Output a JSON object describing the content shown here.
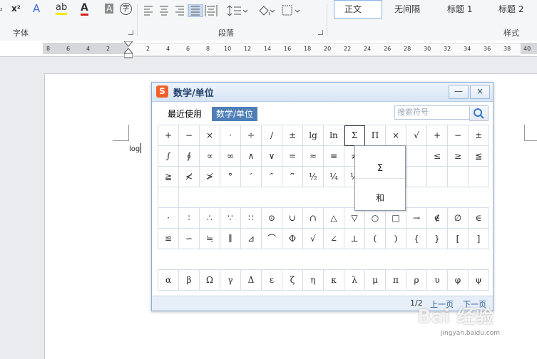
{
  "ribbon": {
    "font_buttons": [
      "₂",
      "x²",
      "A",
      "ab",
      "A",
      "A",
      "字"
    ],
    "para_label": "段落",
    "font_label": "字体",
    "styles_label": "样式",
    "styles": [
      "正文",
      "无间隔",
      "标题 1",
      "标题 2"
    ]
  },
  "ruler": {
    "ticks": [
      "8",
      "6",
      "4",
      "2",
      "2",
      "4",
      "6",
      "8",
      "10",
      "12",
      "14",
      "16",
      "18",
      "20",
      "22",
      "24",
      "26",
      "28",
      "30",
      "32",
      "34",
      "36",
      "38",
      "40"
    ]
  },
  "document": {
    "text": "log"
  },
  "dialog": {
    "logo": "S",
    "title": "数学/单位",
    "minimize": "—",
    "close": "×",
    "tabs": [
      "最近使用",
      "数学/单位"
    ],
    "search_placeholder": "搜索符号",
    "rows_a": [
      "+",
      "−",
      "×",
      "·",
      "÷",
      "∕",
      "±",
      "lg",
      "ln",
      "Σ",
      "Π",
      "×",
      "√",
      "+",
      "−",
      "±",
      "∫",
      "∮",
      "∝",
      "∞",
      "∧",
      "∨",
      "=",
      "≈",
      "≡",
      "≠",
      "",
      "",
      "",
      "≤",
      "≥",
      "≦",
      "≧",
      "≮",
      "≯",
      "°",
      "′",
      "″",
      "‴",
      "½",
      "¼",
      "⅓",
      "",
      "",
      "",
      "",
      "",
      "",
      ""
    ],
    "rows_b": [
      "·",
      "∶",
      "∴",
      "∵",
      "∷",
      "⊙",
      "∪",
      "∩",
      "△",
      "▽",
      "○",
      "□",
      "→",
      "∉",
      "∅",
      "∈",
      "≌",
      "∽",
      "≒",
      "∥",
      "⊿",
      "⌒",
      "Φ",
      "√",
      "∠",
      "⊥",
      "(",
      ")",
      "{",
      "}",
      "[",
      "]"
    ],
    "rows_c": [
      "α",
      "β",
      "Ω",
      "γ",
      "Δ",
      "ε",
      "ζ",
      "η",
      "κ",
      "λ",
      "μ",
      "π",
      "ρ",
      "υ",
      "φ",
      "ψ"
    ],
    "popup": [
      "Σ",
      "和"
    ],
    "page_indicator": "1/2",
    "prev": "上一页",
    "next": "下一页"
  },
  "watermark": {
    "text": "Bai 经验",
    "sub": "jingyan.baidu.com"
  }
}
